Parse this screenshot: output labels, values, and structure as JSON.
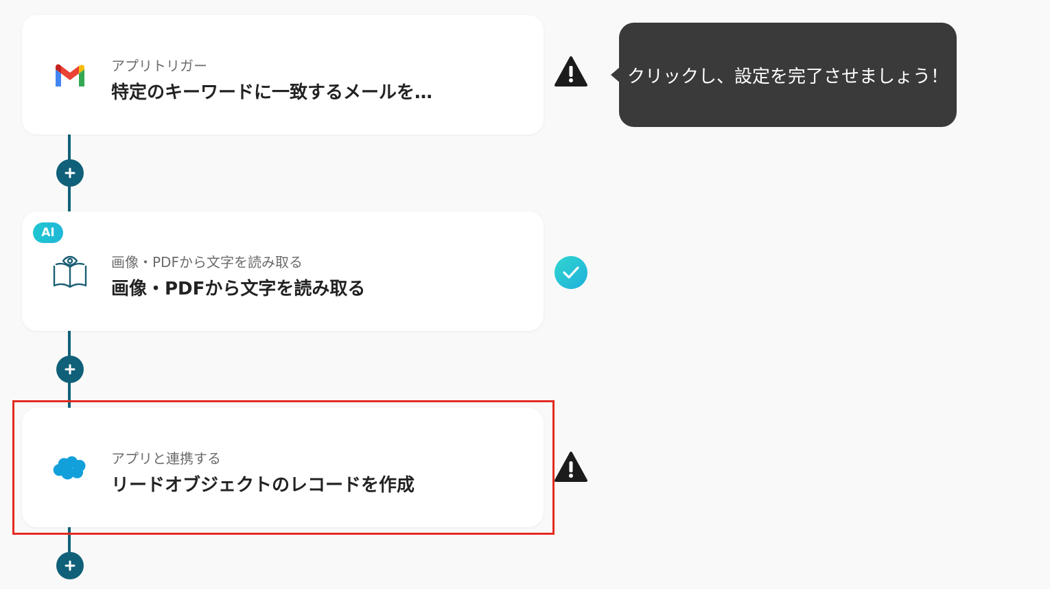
{
  "tooltip": {
    "text": "クリックし、設定を完了させましょう！"
  },
  "steps": [
    {
      "subtitle": "アプリトリガー",
      "title": "特定のキーワードに一致するメールを…",
      "icon": "gmail-icon",
      "status": "warning"
    },
    {
      "badge": "AI",
      "subtitle": "画像・PDFから文字を読み取る",
      "title": "画像・PDFから文字を読み取る",
      "icon": "book-eye-icon",
      "status": "complete"
    },
    {
      "subtitle": "アプリと連携する",
      "title": "リードオブジェクトのレコードを作成",
      "icon": "salesforce-icon",
      "status": "warning",
      "highlighted": true
    }
  ],
  "colors": {
    "connector": "#0f6078",
    "highlight": "#e32b20",
    "check": "#22c3d8",
    "tooltip": "#3a3a3a"
  }
}
